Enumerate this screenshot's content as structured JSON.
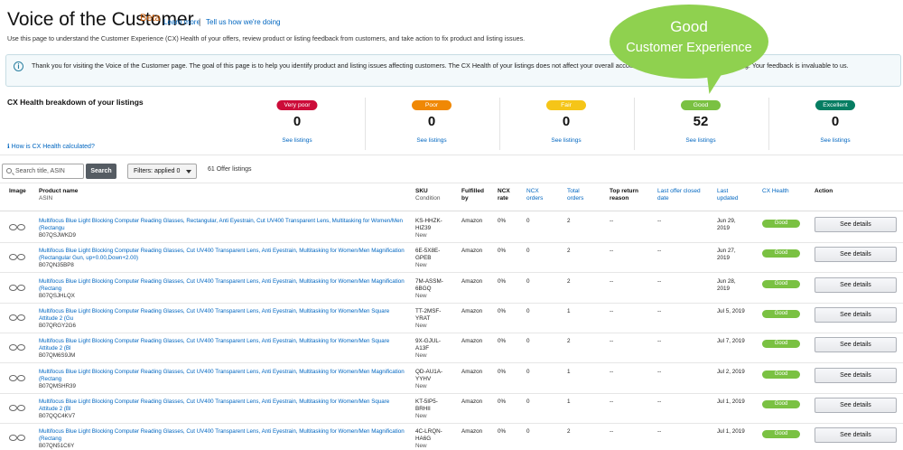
{
  "header": {
    "title": "Voice of the Customer",
    "beta": "Beta",
    "learn_more": "Learn more",
    "separator": "|",
    "tell_us": "Tell us how we're doing",
    "intro": "Use this page to understand the Customer Experience (CX) Health of your offers, review product or listing feedback from customers, and take action to fix product and listing issues."
  },
  "banner": {
    "icon": "info-icon",
    "text": "Thank you for visiting the Voice of the Customer page. The goal of this page is to help you identify product and listing issues affecting customers. The CX Health of your listings does not affect your overall account health. Please tell us how we're doing. Your feedback is invaluable to us."
  },
  "callout": {
    "line1": "Good",
    "line2": "Customer Experience",
    "color": "#8fd14f"
  },
  "cx_health": {
    "title": "CX Health breakdown of your listings",
    "how_calculated": "How is CX Health calculated?",
    "categories": [
      {
        "label": "Very poor",
        "count": "0",
        "link": "See listings",
        "color": "#cc0c39"
      },
      {
        "label": "Poor",
        "count": "0",
        "link": "See listings",
        "color": "#f08804"
      },
      {
        "label": "Fair",
        "count": "0",
        "link": "See listings",
        "color": "#f5c518"
      },
      {
        "label": "Good",
        "count": "52",
        "link": "See listings",
        "color": "#7ac142"
      },
      {
        "label": "Excellent",
        "count": "0",
        "link": "See listings",
        "color": "#067d62"
      }
    ]
  },
  "toolbar": {
    "search_placeholder": "Search title, ASIN",
    "search_button": "Search",
    "filters": "Filters: applied 0",
    "offer_count": "61 Offer listings"
  },
  "table": {
    "headers": {
      "image": "Image",
      "product_name": "Product name",
      "asin": "ASIN",
      "sku": "SKU",
      "condition": "Condition",
      "fulfilled_1": "Fulfilled",
      "fulfilled_2": "by",
      "ncx_rate_1": "NCX",
      "ncx_rate_2": "rate",
      "ncx_orders_1": "NCX",
      "ncx_orders_2": "orders",
      "total_orders_1": "Total",
      "total_orders_2": "orders",
      "top_return_1": "Top return",
      "top_return_2": "reason",
      "last_offer_1": "Last offer closed",
      "last_offer_2": "date",
      "last_updated_1": "Last",
      "last_updated_2": "updated",
      "cx_health": "CX Health",
      "action": "Action"
    },
    "rows": [
      {
        "name": "Multifocus Blue Light Blocking Computer Reading Glasses, Rectangular, Anti Eyestrain, Cut UV400 Transparent Lens, Multitasking for Women/Men (Rectangu",
        "asin": "B07QSJWKD9",
        "sku1": "KS-HHZK-",
        "sku2": "HIZ39",
        "condition": "New",
        "fulfilled": "Amazon",
        "ncx_rate": "0%",
        "ncx_orders": "0",
        "total_orders": "2",
        "top_return": "--",
        "last_offer": "--",
        "updated1": "Jun 29,",
        "updated2": "2019",
        "health": "Good",
        "action": "See details"
      },
      {
        "name": "Multifocus Blue Light Blocking Computer Reading Glasses, Cut UV400 Transparent Lens, Anti Eyestrain, Multitasking for Women/Men Magnification (Rectangular Gun, up+0.00,Down+2.00)",
        "asin": "B07QN35BP8",
        "sku1": "6E-5X8E-",
        "sku2": "GPEB",
        "condition": "New",
        "fulfilled": "Amazon",
        "ncx_rate": "0%",
        "ncx_orders": "0",
        "total_orders": "2",
        "top_return": "--",
        "last_offer": "--",
        "updated1": "Jun 27,",
        "updated2": "2019",
        "health": "Good",
        "action": "See details"
      },
      {
        "name": "Multifocus Blue Light Blocking Computer Reading Glasses, Cut UV400 Transparent Lens, Anti Eyestrain, Multitasking for Women/Men Magnification (Rectang",
        "asin": "B07QSJHLQX",
        "sku1": "7M-ASSM-",
        "sku2": "6BGQ",
        "condition": "New",
        "fulfilled": "Amazon",
        "ncx_rate": "0%",
        "ncx_orders": "0",
        "total_orders": "2",
        "top_return": "--",
        "last_offer": "--",
        "updated1": "Jun 28,",
        "updated2": "2019",
        "health": "Good",
        "action": "See details"
      },
      {
        "name": "Multifocus Blue Light Blocking Computer Reading Glasses, Cut UV400 Transparent Lens, Anti Eyestrain, Multitasking for Women/Men Square Attitude 2 (Gu",
        "asin": "B07QRGY2G6",
        "sku1": "TT-2MSF-",
        "sku2": "YRAT",
        "condition": "New",
        "fulfilled": "Amazon",
        "ncx_rate": "0%",
        "ncx_orders": "0",
        "total_orders": "1",
        "top_return": "--",
        "last_offer": "--",
        "updated1": "Jul 5, 2019",
        "updated2": "",
        "health": "Good",
        "action": "See details"
      },
      {
        "name": "Multifocus Blue Light Blocking Computer Reading Glasses, Cut UV400 Transparent Lens, Anti Eyestrain, Multitasking for Women/Men Square Attitude 2 (Bl",
        "asin": "B07QM6S9JM",
        "sku1": "9X-GJUL-",
        "sku2": "A13F",
        "condition": "New",
        "fulfilled": "Amazon",
        "ncx_rate": "0%",
        "ncx_orders": "0",
        "total_orders": "2",
        "top_return": "--",
        "last_offer": "--",
        "updated1": "Jul 7, 2019",
        "updated2": "",
        "health": "Good",
        "action": "See details"
      },
      {
        "name": "Multifocus Blue Light Blocking Computer Reading Glasses, Cut UV400 Transparent Lens, Anti Eyestrain, Multitasking for Women/Men Magnification (Rectang",
        "asin": "B07QMSHR39",
        "sku1": "QD-AU1A-",
        "sku2": "YYHV",
        "condition": "New",
        "fulfilled": "Amazon",
        "ncx_rate": "0%",
        "ncx_orders": "0",
        "total_orders": "1",
        "top_return": "--",
        "last_offer": "--",
        "updated1": "Jul 2, 2019",
        "updated2": "",
        "health": "Good",
        "action": "See details"
      },
      {
        "name": "Multifocus Blue Light Blocking Computer Reading Glasses, Cut UV400 Transparent Lens, Anti Eyestrain, Multitasking for Women/Men Square Attitude 2 (Bl",
        "asin": "B07QQC4KV7",
        "sku1": "KT-5IP5-",
        "sku2": "BRHII",
        "condition": "New",
        "fulfilled": "Amazon",
        "ncx_rate": "0%",
        "ncx_orders": "0",
        "total_orders": "1",
        "top_return": "--",
        "last_offer": "--",
        "updated1": "Jul 1, 2019",
        "updated2": "",
        "health": "Good",
        "action": "See details"
      },
      {
        "name": "Multifocus Blue Light Blocking Computer Reading Glasses, Cut UV400 Transparent Lens, Anti Eyestrain, Multitasking for Women/Men Magnification (Rectang",
        "asin": "B07QN51C6Y",
        "sku1": "4C-LRQN-",
        "sku2": "HA6G",
        "condition": "New",
        "fulfilled": "Amazon",
        "ncx_rate": "0%",
        "ncx_orders": "0",
        "total_orders": "2",
        "top_return": "--",
        "last_offer": "--",
        "updated1": "Jul 1, 2019",
        "updated2": "",
        "health": "Good",
        "action": "See details"
      }
    ]
  }
}
